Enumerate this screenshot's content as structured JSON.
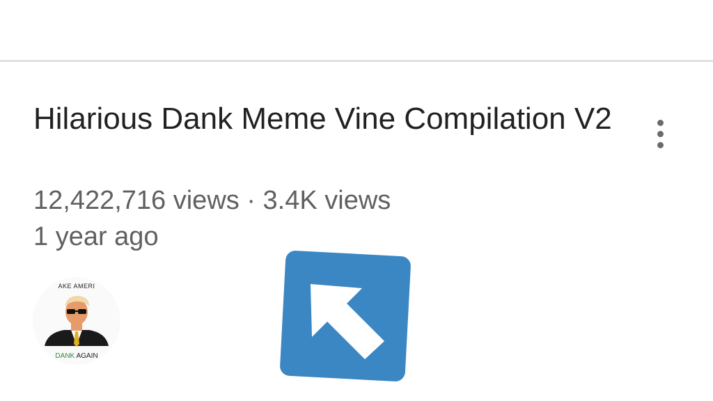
{
  "video": {
    "title": "Hilarious Dank Meme Vine Compilation V2",
    "views": "12,422,716 views",
    "separator": "·",
    "secondary_views": "3.4K views",
    "age": "1 year ago"
  },
  "avatar": {
    "top_text": "AKE AMERI",
    "bottom_green": "DANK",
    "bottom_dark": "AGAIN"
  },
  "colors": {
    "title": "#212121",
    "meta": "#606060",
    "divider": "#e0e0e0",
    "arrow_tile": "#3a87c4",
    "arrow": "#ffffff"
  },
  "icons": {
    "more": "more-vert-icon",
    "arrow": "arrow-up-left-icon"
  }
}
